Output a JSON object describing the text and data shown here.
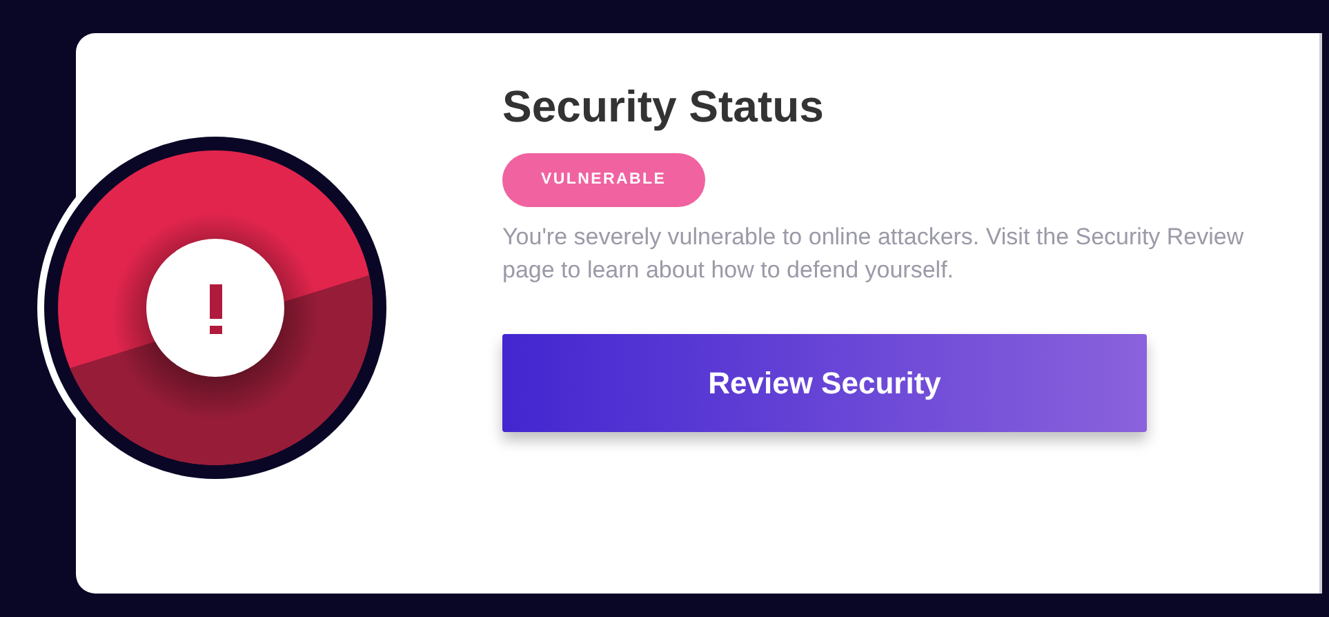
{
  "status": {
    "title": "Security Status",
    "kind": "alert",
    "badge": "VULNERABLE",
    "description": "You're severely vulnerable to online attackers. Visit the Security Review page to learn about how to defend yourself.",
    "button": "Review Security"
  }
}
